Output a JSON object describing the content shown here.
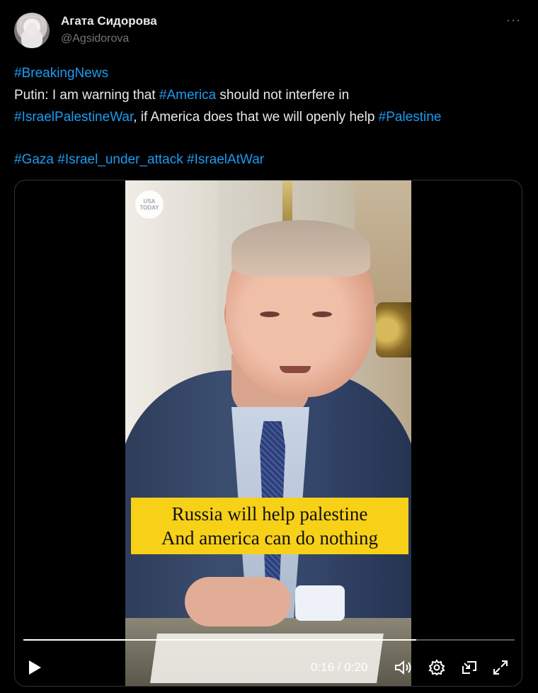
{
  "author": {
    "display_name": "Агата Сидорова",
    "handle": "@Agsidorova"
  },
  "more_menu_glyph": "···",
  "tweet": {
    "line1_tag": "#BreakingNews",
    "line2_text": "Putin: I am warning that ",
    "line2_tag": "#America",
    "line2_text2": " should not interfere in",
    "line3_tag": "#IsraelPalestineWar",
    "line3_text": ", if America does that we will openly help ",
    "line3_tag2": "#Palestine",
    "line4_tag1": "#Gaza",
    "line4_tag2": "#Israel_under_attack",
    "line4_tag3": "#IsraelAtWar"
  },
  "video": {
    "watermark": "USA TODAY",
    "caption_line1": "Russia will help palestine",
    "caption_line2": "And america can do nothing",
    "current_time": "0:16",
    "duration": "0:20",
    "time_display": "0:16 / 0:20",
    "progress_fraction": 0.8
  },
  "colors": {
    "background": "#000000",
    "text": "#e7e9ea",
    "secondary_text": "#71767b",
    "link": "#1d9bf0",
    "caption_bg": "#f7d018"
  },
  "icons": [
    "play-icon",
    "volume-icon",
    "settings-icon",
    "picture-in-picture-icon",
    "fullscreen-icon",
    "more-options-icon"
  ]
}
